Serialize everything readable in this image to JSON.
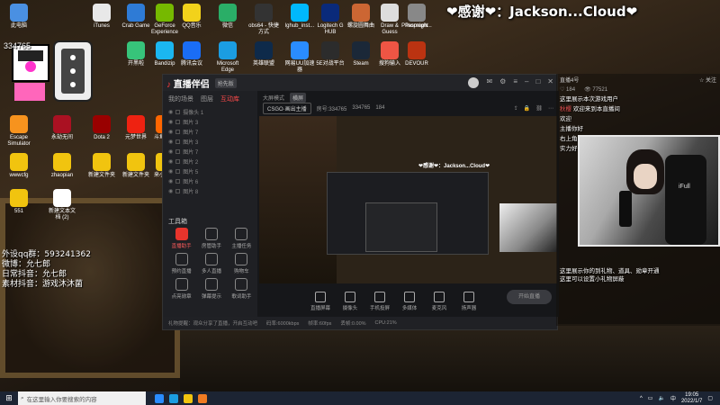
{
  "overlay": {
    "thanks_text": "❤感谢❤：Jackson...Cloud❤",
    "view_count": "334765",
    "info_lines": [
      "外设qq群：593241362",
      "微博：允七郎",
      "日常抖音：允七郎",
      "素材抖音：游戏沐沐菌"
    ]
  },
  "desktop_icons": [
    {
      "label": "此电脑",
      "color": "#4a90e2"
    },
    {
      "label": "iTunes",
      "color": "#e8e8e8"
    },
    {
      "label": "Crab Game",
      "color": "#2e7bd6"
    },
    {
      "label": "GeForce Experience",
      "color": "#76b900"
    },
    {
      "label": "QQ音乐",
      "color": "#f2d21b"
    },
    {
      "label": "微信",
      "color": "#2aae67"
    },
    {
      "label": "obs64 - 快捷方式",
      "color": "#333"
    },
    {
      "label": "lghub_inst...",
      "color": "#00b8fc"
    },
    {
      "label": "Logitech G HUB",
      "color": "#0a2a7a"
    },
    {
      "label": "螺旋圆舞曲",
      "color": "#c63"
    },
    {
      "label": "Draw & Guess",
      "color": "#ddd"
    },
    {
      "label": "Phasmoph...",
      "color": "#222"
    },
    {
      "label": "Propnight",
      "color": "#888"
    },
    {
      "label": "开黑啦",
      "color": "#37c47a"
    },
    {
      "label": "Bandizip",
      "color": "#1bb7f0"
    },
    {
      "label": "腾讯会议",
      "color": "#1a6df5"
    },
    {
      "label": "Microsoft Edge",
      "color": "#1b9de2"
    },
    {
      "label": "英雄联盟",
      "color": "#0e2a4a"
    },
    {
      "label": "网易UU加速器",
      "color": "#2a8cff"
    },
    {
      "label": "5E对战平台",
      "color": "#2c2c2c"
    },
    {
      "label": "Steam",
      "color": "#1b2838"
    },
    {
      "label": "搜狗输入",
      "color": "#e54"
    },
    {
      "label": "DEVOUR",
      "color": "#b31"
    },
    {
      "label": "Escape Simulator",
      "color": "#f7931e"
    },
    {
      "label": "永劫无间",
      "color": "#a12"
    },
    {
      "label": "Dota 2",
      "color": "#900"
    },
    {
      "label": "元梦世界",
      "color": "#e21"
    },
    {
      "label": "斗鱼直播",
      "color": "#f60"
    },
    {
      "label": "wwwcfg",
      "color": "#f1c40f"
    },
    {
      "label": "zhaopian",
      "color": "#f1c40f"
    },
    {
      "label": "新建文件夹",
      "color": "#f1c40f"
    },
    {
      "label": "新建文件夹",
      "color": "#f1c40f"
    },
    {
      "label": "来小视频",
      "color": "#f1c40f"
    },
    {
      "label": "551",
      "color": "#f1c40f"
    },
    {
      "label": "新建文本文档 (2)",
      "color": "#fff"
    }
  ],
  "app": {
    "logo": "直播伴侣",
    "version_badge": "抢先版",
    "tabs": [
      "我的场景",
      "图层",
      "互动库"
    ],
    "active_tab_index": 2,
    "scenes": [
      "摄像头 1",
      "图片 3",
      "图片 7",
      "图片 3",
      "图片 7",
      "图片 2",
      "图片 5",
      "图片 6",
      "图片 8"
    ],
    "tools_title": "工具箱",
    "tools": [
      {
        "label": "直播助手"
      },
      {
        "label": "房管助手"
      },
      {
        "label": "主播任务"
      },
      {
        "label": "预约直播"
      },
      {
        "label": "多人直播"
      },
      {
        "label": "购物车"
      },
      {
        "label": "点亮勋章"
      },
      {
        "label": "弹幕提示"
      },
      {
        "label": "歌词助手"
      }
    ],
    "active_tool_index": 0,
    "center_header": {
      "mode": "大屏模式",
      "title_chip": "横屏",
      "game": "CSGO·画出主播",
      "room_id": "房号:334765",
      "viewers": "334765",
      "fans": "184"
    },
    "bottom_tools": [
      "直播屏幕",
      "摄像头",
      "手机投屏",
      "多媒体",
      "麦克风",
      "扬声器"
    ],
    "start_button": "开始直播",
    "status_bar": [
      "礼物提醒：观众分享了直播，开启互动吧",
      "码率:6000kbps",
      "帧率:60fps",
      "丢帧:0.00%",
      "CPU:21%"
    ]
  },
  "chat": {
    "header_left": "直播4号",
    "header_right": "☆ 关注",
    "stats": [
      "♡ 184",
      "👁 77521"
    ],
    "messages": [
      {
        "user": "",
        "text": "这里展示本次游戏用户"
      },
      {
        "user": "秋樱",
        "text": "欢迎来到本直播间"
      },
      {
        "user": "",
        "text": "欢迎"
      },
      {
        "user": "",
        "text": "主播你好"
      },
      {
        "user": "",
        "text": "右上角点关注"
      },
      {
        "user": "",
        "text": "实力好"
      }
    ],
    "notice": "这里展示你的到礼物、道具、勋章开通\n这里可以设置小礼物屏蔽"
  },
  "webcam": {
    "chair_brand": "iFull"
  },
  "taskbar": {
    "search_placeholder": "在这里输入你要搜索的内容",
    "time": "19:05",
    "date": "2022/1/7",
    "lang": "中"
  }
}
